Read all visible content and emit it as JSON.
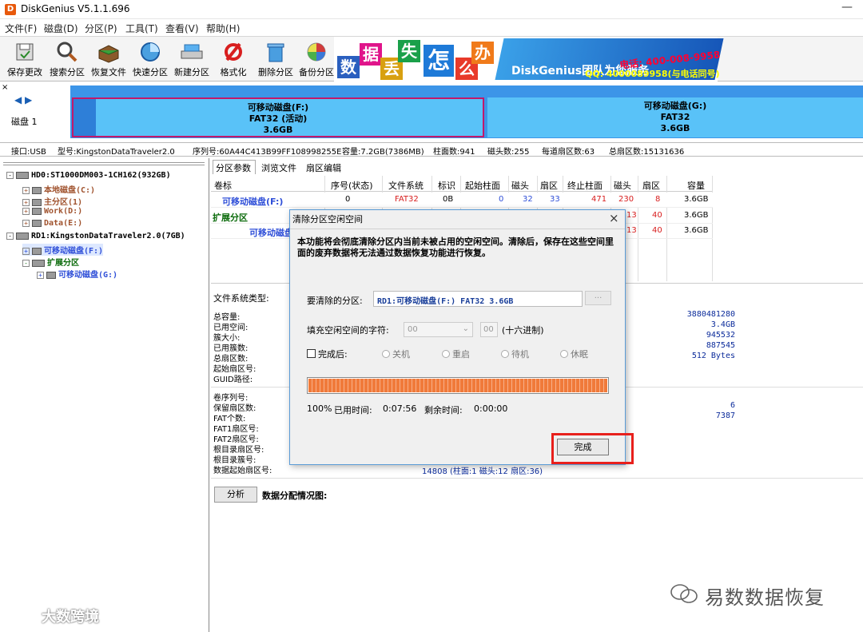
{
  "window": {
    "title": "DiskGenius V5.1.1.696",
    "min": "—"
  },
  "menu": [
    "文件(F)",
    "磁盘(D)",
    "分区(P)",
    "工具(T)",
    "查看(V)",
    "帮助(H)"
  ],
  "toolbar": [
    "保存更改",
    "搜索分区",
    "恢复文件",
    "快速分区",
    "新建分区",
    "格式化",
    "删除分区",
    "备份分区"
  ],
  "banner": {
    "chars": [
      "数",
      "据",
      "丢",
      "失",
      "怎",
      "么",
      "办"
    ],
    "brand": "DiskGenius团队为您服务",
    "phone": "电话: 400-008-9958",
    "qq": "QQ: 4000089958(与电话同号)"
  },
  "diskmap": {
    "close": "×",
    "nav": "◀ ▶",
    "disk_label": "磁盘 1",
    "partF": {
      "name": "可移动磁盘(F:)",
      "fs": "FAT32 (活动)",
      "size": "3.6GB"
    },
    "partG": {
      "name": "可移动磁盘(G:)",
      "fs": "FAT32",
      "size": "3.6GB"
    }
  },
  "infobar": {
    "iface": "接口:USB",
    "model": "型号:KingstonDataTraveler2.0",
    "serial": "序列号:60A44C413B99FF108998255E",
    "capacity": "容量:7.2GB(7386MB)",
    "cyl": "柱面数:941",
    "heads": "磁头数:255",
    "spt": "每道扇区数:63",
    "total": "总扇区数:15131636"
  },
  "tree": [
    "HD0:ST1000DM003-1CH162(932GB)",
    "本地磁盘(C:)",
    "主分区(1)",
    "Work(D:)",
    "Data(E:)",
    "RD1:KingstonDataTraveler2.0(7GB)",
    "可移动磁盘(F:)",
    "扩展分区",
    "可移动磁盘(G:)"
  ],
  "tabs": [
    "分区参数",
    "浏览文件",
    "扇区编辑"
  ],
  "table": {
    "headers": [
      "卷标",
      "序号(状态)",
      "文件系统",
      "标识",
      "起始柱面",
      "磁头",
      "扇区",
      "终止柱面",
      "磁头",
      "扇区",
      "容量"
    ],
    "rows": [
      [
        "可移动磁盘(F:)",
        "0",
        "FAT32",
        "0B",
        "0",
        "32",
        "33",
        "471",
        "230",
        "8",
        "3.6GB"
      ],
      [
        "扩展分区",
        "",
        "",
        "",
        "",
        "",
        "",
        "",
        "13",
        "40",
        "3.6GB"
      ],
      [
        "可移动磁盘",
        "",
        "",
        "",
        "",
        "",
        "",
        "",
        "13",
        "40",
        "3.6GB"
      ]
    ]
  },
  "details": {
    "fs_type": "文件系统类型:",
    "labels1": [
      "总容量:",
      "已用空间:",
      "簇大小:",
      "已用簇数:",
      "总扇区数:",
      "起始扇区号:",
      "GUID路径:"
    ],
    "values1": [
      "3880481280",
      "3.4GB",
      "945532",
      "887545",
      "512 Bytes"
    ],
    "labels2": [
      "卷序列号:",
      "保留扇区数:",
      "FAT个数:",
      "FAT1扇区号:",
      "FAT2扇区号:",
      "根目录扇区号:",
      "根目录簇号:",
      "数据起始扇区号:"
    ],
    "values2": [
      "6",
      "7387"
    ],
    "data_start": "14808 (柱面:1 磁头:12 扇区:36)",
    "analyze": "分析",
    "alloc": "数据分配情况图:"
  },
  "dialog": {
    "title": "清除分区空闲空间",
    "close": "×",
    "message": "本功能将会彻底清除分区内当前未被占用的空闲空间。清除后，保存在这些空间里面的废弃数据将无法通过数据恢复功能进行恢复。",
    "target_label": "要清除的分区:",
    "target_value": "RD1:可移动磁盘(F:) FAT32 3.6GB",
    "browse": "...",
    "fill_label": "填充空闲空间的字符:",
    "fill_select": "00",
    "fill_hex": "00",
    "hex_note": "(十六进制)",
    "after_label": "完成后:",
    "options": [
      "关机",
      "重启",
      "待机",
      "休眠"
    ],
    "progress": 1.0,
    "percent": "100%",
    "elapsed_label": "已用时间:",
    "elapsed": "0:07:56",
    "remaining_label": "剩余时间:",
    "remaining": "0:00:00",
    "done": "完成"
  },
  "watermark": {
    "right": "易数数据恢复",
    "left": "大数跨境"
  }
}
